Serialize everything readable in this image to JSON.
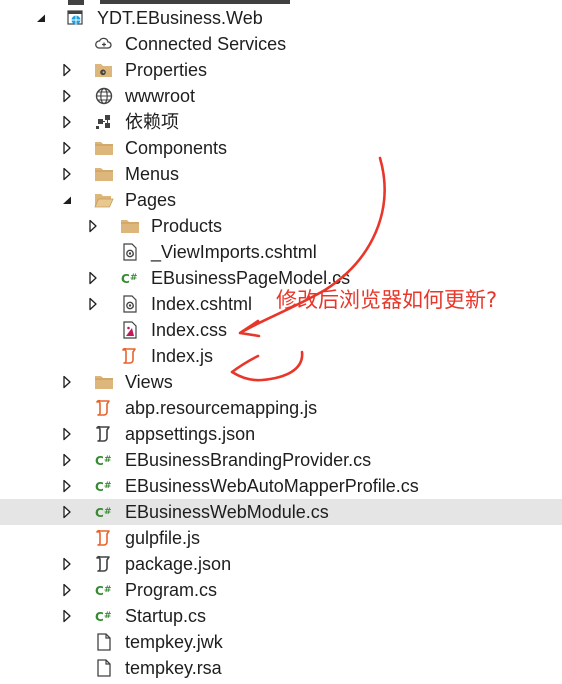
{
  "tree": [
    {
      "label": "YDT.EBusiness.Web",
      "icon": "web-project-icon",
      "expander": "expanded",
      "depth": 0
    },
    {
      "label": "Connected Services",
      "icon": "connected-services-icon",
      "expander": "none",
      "depth": 1
    },
    {
      "label": "Properties",
      "icon": "properties-folder-icon",
      "expander": "collapsed",
      "depth": 1
    },
    {
      "label": "wwwroot",
      "icon": "globe-icon",
      "expander": "collapsed",
      "depth": 1
    },
    {
      "label": "依赖项",
      "icon": "dependencies-icon",
      "expander": "collapsed",
      "depth": 1
    },
    {
      "label": "Components",
      "icon": "folder-icon",
      "expander": "collapsed",
      "depth": 1
    },
    {
      "label": "Menus",
      "icon": "folder-icon",
      "expander": "collapsed",
      "depth": 1
    },
    {
      "label": "Pages",
      "icon": "folder-open-icon",
      "expander": "expanded",
      "depth": 1
    },
    {
      "label": "Products",
      "icon": "folder-icon",
      "expander": "collapsed",
      "depth": 2
    },
    {
      "label": "_ViewImports.cshtml",
      "icon": "razor-file-icon",
      "expander": "none",
      "depth": 2
    },
    {
      "label": "EBusinessPageModel.cs",
      "icon": "csharp-file-icon",
      "expander": "collapsed",
      "depth": 2
    },
    {
      "label": "Index.cshtml",
      "icon": "razor-file-icon",
      "expander": "collapsed",
      "depth": 2
    },
    {
      "label": "Index.css",
      "icon": "css-file-icon",
      "expander": "none",
      "depth": 2
    },
    {
      "label": "Index.js",
      "icon": "js-file-icon",
      "expander": "none",
      "depth": 2
    },
    {
      "label": "Views",
      "icon": "folder-icon",
      "expander": "collapsed",
      "depth": 1
    },
    {
      "label": "abp.resourcemapping.js",
      "icon": "js-file-icon",
      "expander": "none",
      "depth": 1
    },
    {
      "label": "appsettings.json",
      "icon": "json-file-icon",
      "expander": "collapsed",
      "depth": 1
    },
    {
      "label": "EBusinessBrandingProvider.cs",
      "icon": "csharp-file-icon",
      "expander": "collapsed",
      "depth": 1
    },
    {
      "label": "EBusinessWebAutoMapperProfile.cs",
      "icon": "csharp-file-icon",
      "expander": "collapsed",
      "depth": 1
    },
    {
      "label": "EBusinessWebModule.cs",
      "icon": "csharp-file-icon",
      "expander": "collapsed",
      "depth": 1,
      "selected": true
    },
    {
      "label": "gulpfile.js",
      "icon": "js-file-icon",
      "expander": "none",
      "depth": 1
    },
    {
      "label": "package.json",
      "icon": "json-file-icon",
      "expander": "collapsed",
      "depth": 1
    },
    {
      "label": "Program.cs",
      "icon": "csharp-file-icon",
      "expander": "collapsed",
      "depth": 1
    },
    {
      "label": "Startup.cs",
      "icon": "csharp-file-icon",
      "expander": "collapsed",
      "depth": 1
    },
    {
      "label": "tempkey.jwk",
      "icon": "file-icon",
      "expander": "none",
      "depth": 1
    },
    {
      "label": "tempkey.rsa",
      "icon": "file-icon",
      "expander": "none",
      "depth": 1
    }
  ],
  "annotation": {
    "text": "修改后浏览器如何更新?",
    "color": "#e8372a"
  },
  "colors": {
    "folder": "#dcb67a",
    "csharp": "#388a34",
    "js": "#e8632c",
    "selected": "#e5e5e5",
    "expander": "#1e1e1e"
  }
}
